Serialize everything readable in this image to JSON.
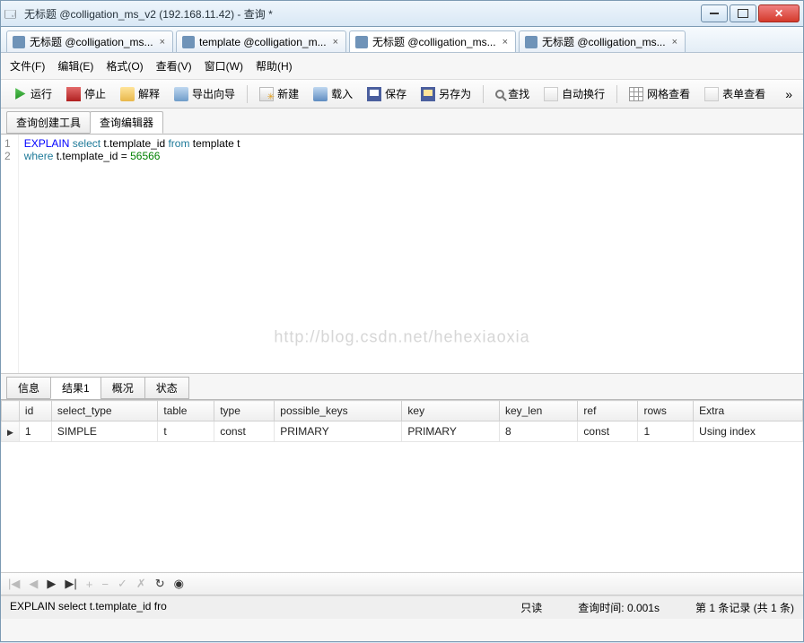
{
  "window": {
    "title": "无标题 @colligation_ms_v2 (192.168.11.42) - 查询 *"
  },
  "doctabs": [
    {
      "label": "无标题 @colligation_ms...",
      "active": false
    },
    {
      "label": "template @colligation_m...",
      "active": false
    },
    {
      "label": "无标题 @colligation_ms...",
      "active": true
    },
    {
      "label": "无标题 @colligation_ms...",
      "active": false
    }
  ],
  "menubar": {
    "file": "文件(F)",
    "edit": "编辑(E)",
    "format": "格式(O)",
    "view": "查看(V)",
    "window": "窗口(W)",
    "help": "帮助(H)"
  },
  "toolbar": {
    "run": "运行",
    "stop": "停止",
    "explain": "解释",
    "export": "导出向导",
    "new": "新建",
    "load": "载入",
    "save": "保存",
    "saveas": "另存为",
    "find": "查找",
    "wrap": "自动换行",
    "gridview": "网格查看",
    "formview": "表单查看"
  },
  "subtabs": {
    "builder": "查询创建工具",
    "editor": "查询编辑器"
  },
  "sql": {
    "lines": [
      "1",
      "2"
    ],
    "l1": {
      "a": "EXPLAIN",
      "b": "select",
      "c": " t.template_id ",
      "d": "from",
      "e": " template t"
    },
    "l2": {
      "a": "where",
      "b": " t.template_id = ",
      "c": "56566"
    }
  },
  "watermark": "http://blog.csdn.net/hehexiaoxia",
  "resulttabs": {
    "info": "信息",
    "result": "结果1",
    "profile": "概况",
    "status": "状态"
  },
  "grid": {
    "headers": {
      "id": "id",
      "select_type": "select_type",
      "table": "table",
      "type": "type",
      "possible_keys": "possible_keys",
      "key": "key",
      "key_len": "key_len",
      "ref": "ref",
      "rows": "rows",
      "extra": "Extra"
    },
    "rows": [
      {
        "id": "1",
        "select_type": "SIMPLE",
        "table": "t",
        "type": "const",
        "possible_keys": "PRIMARY",
        "key": "PRIMARY",
        "key_len": "8",
        "ref": "const",
        "rows": "1",
        "extra": "Using index"
      }
    ]
  },
  "statusbar": {
    "query": "EXPLAIN select t.template_id fro",
    "readonly": "只读",
    "time": "查询时间: 0.001s",
    "record": "第 1 条记录 (共 1 条)"
  },
  "nav": {
    "first": "|◀",
    "prev": "◀",
    "play": "▶",
    "next": "▶|",
    "add": "+",
    "del": "−",
    "ok": "✓",
    "cancel": "✗",
    "refresh": "↻",
    "end": "◉"
  }
}
